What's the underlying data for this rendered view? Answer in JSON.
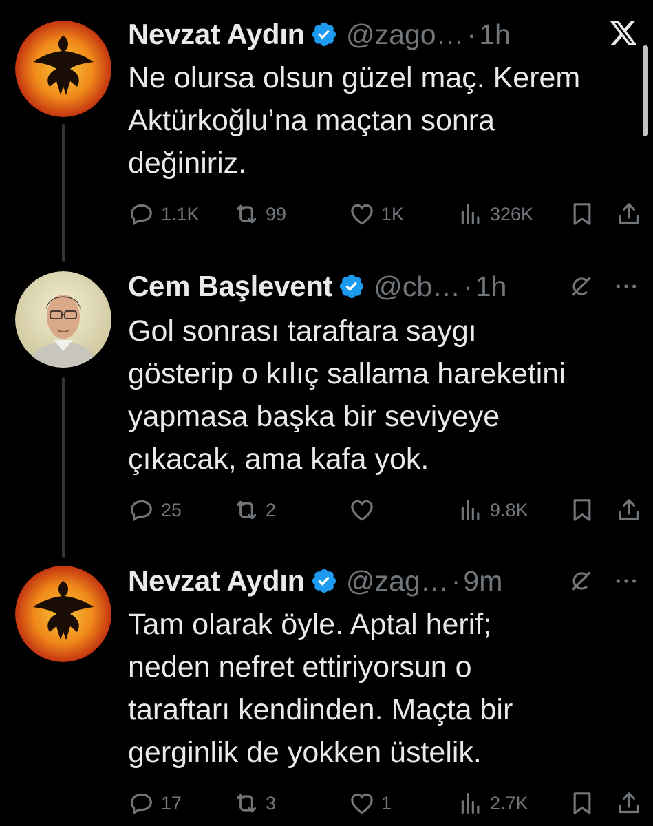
{
  "tweets": [
    {
      "author": "Nevzat Aydın",
      "handle": "@zago…",
      "separator": "·",
      "time": "1h",
      "text": "Ne olursa olsun güzel maç. Kerem\nAktürkoğlu’na maçtan sonra\ndeğiniriz.",
      "replies": "1.1K",
      "reposts": "99",
      "likes": "1K",
      "views": "326K"
    },
    {
      "author": "Cem Başlevent",
      "handle": "@cb…",
      "separator": "·",
      "time": "1h",
      "text": "Gol sonrası taraftara saygı\ngösterip o kılıç sallama hareketini\nyapmasa başka bir seviyeye\nçıkacak, ama kafa yok.",
      "replies": "25",
      "reposts": "2",
      "likes": "",
      "views": "9.8K"
    },
    {
      "author": "Nevzat Aydın",
      "handle": "@zag…",
      "separator": "·",
      "time": "9m",
      "text": "Tam olarak öyle. Aptal herif;\nneden nefret ettiriyorsun o\ntaraftarı kendinden. Maçta bir\ngerginlik de yokken üstelik.",
      "replies": "17",
      "reposts": "3",
      "likes": "1",
      "views": "2.7K"
    }
  ],
  "colors": {
    "background": "#000000",
    "text": "#e7e9ea",
    "muted": "#71767b",
    "verified": "#1d9bf0",
    "thread_line": "#333639"
  }
}
